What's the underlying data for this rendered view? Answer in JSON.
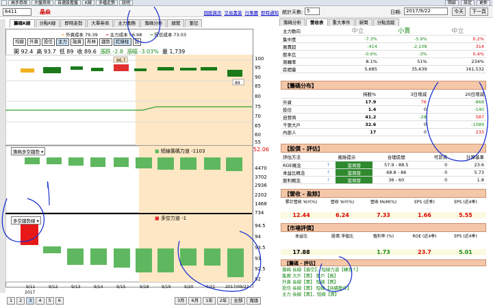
{
  "topbar": {
    "items": [
      "",
      "高手券商",
      "大盤券商",
      "自選股看盤",
      "K線",
      "多檔走勢",
      "說明"
    ],
    "right": [
      "",
      "開啟",
      "",
      "設定",
      "",
      "更新"
    ]
  },
  "header": {
    "code": "6411",
    "name": "晶焱",
    "links": [
      "個股資訊",
      "交易書簽",
      "行事曆",
      "即時通知"
    ]
  },
  "left_tabs": [
    "籌碼K線",
    "分點K線",
    "即時走勢",
    "大單券商",
    "主力動態",
    "籌碼分析",
    "總覽",
    "筆記"
  ],
  "legend": [
    {
      "label": "外資成本 79.39",
      "color": "#f0a030"
    },
    {
      "label": "主力成本 56.98",
      "color": "#e03030"
    },
    {
      "label": "投信成本 73.03",
      "color": "#30a030"
    }
  ],
  "buttons": [
    "均線",
    "外資",
    "投信",
    "主力",
    "融資",
    "布林",
    "趨勢",
    "紅綠柱",
    "說"
  ],
  "ohlc": {
    "open": "開 92.4",
    "high": "高 93.7",
    "low": "低 89",
    "close": "收 89.6",
    "change": "漲跌 -2.8",
    "pct": "漲幅 -3.03%",
    "vol": "量 1,739"
  },
  "price_axis": [
    "105",
    "100",
    "95",
    "90",
    "85",
    "80",
    "75",
    "70",
    "65",
    "60",
    "55",
    "52.06"
  ],
  "price_tags": {
    "hi": "96.7",
    "lo": "89"
  },
  "vol_axis": [
    "4470",
    "3702",
    "2936",
    "2202",
    "1468",
    "734",
    "0"
  ],
  "bbig_axis": [
    "94.5",
    "94",
    "93.5",
    "93",
    "92.5",
    "92"
  ],
  "panel2_title": "籌碼多空趨勢",
  "panel2_legend": "短線籌碼力道 -1103",
  "panel3_title": "多空趨勢線",
  "panel3_legend": "多空力道 -1",
  "dates": [
    "9/11",
    "9/12",
    "9/13",
    "9/14",
    "9/15",
    "9/18",
    "9/19",
    "9/20",
    "9/21",
    "2017/09/22"
  ],
  "year": "2017",
  "bottomnav": [
    "1",
    "2",
    "3",
    "4",
    "5",
    "6",
    "3月",
    "6月",
    "1年",
    "2年",
    "全部",
    "寬版"
  ],
  "right": {
    "days_label": "統計天數:",
    "days_value": "5",
    "date_label": "日期:",
    "date_value": "2017/9/22",
    "btns": [
      "今天",
      "下一頁"
    ],
    "tabs": [
      "籌碼分析",
      "營收表",
      "重大事件",
      "新聞",
      "分點追蹤"
    ],
    "top_rows": [
      {
        "label": "主力動向",
        "v1": "中立",
        "v2": "小賣",
        "v3": "中立"
      },
      {
        "label": "集中度",
        "v1": "-7.3%",
        "v2": "-5.9%",
        "v3": "0.2%"
      },
      {
        "label": "買賣超",
        "v1": "-414",
        "v2": "-2,108",
        "v3": "314"
      },
      {
        "label": "股本比",
        "v1": "-0.6%",
        "v2": "-3%",
        "v3": "0.4%"
      },
      {
        "label": "周轉率",
        "v1": "8.1%",
        "v2": "51%",
        "v3": "234%"
      },
      {
        "label": "區間量",
        "v1": "5,685",
        "v2": "35,639",
        "v3": "161,532"
      }
    ],
    "dist_title": "【籌碼分布】",
    "dist_head": [
      "",
      "持股%",
      "3日增減",
      "20日增減"
    ],
    "dist_rows": [
      [
        "外資",
        "17.9",
        "76",
        "-868"
      ],
      [
        "投信",
        "1.4",
        "0",
        "-140"
      ],
      [
        "自營商",
        "41.2",
        "-28",
        "587"
      ],
      [
        "千張大戶",
        "32.6",
        "0",
        "-1089"
      ],
      [
        "內部人",
        "17",
        "0",
        "233"
      ]
    ],
    "eval_title": "【股價 - 評估】",
    "eval_head": [
      "評估方法",
      "",
      "風險提示",
      "合理區間",
      "可昂貴",
      "計算基準"
    ],
    "eval_rows": [
      [
        "ROE概念",
        "?",
        "當周發",
        "57.9 - 88.5",
        "0",
        "23.6"
      ],
      [
        "本益比概念",
        "?",
        "當周發",
        "68.8 - 86",
        "0",
        "5.73"
      ],
      [
        "股利概念",
        "?",
        "當周發",
        "36 - 60",
        "0",
        "1.8"
      ]
    ],
    "rev_title": "【營收 - 盈餘】",
    "rev_head": [
      "累計營收 YoY(%)",
      "營收 YoY(%)",
      "營收 MoM(%)",
      "EPS (近季)",
      "EPS (近4季)"
    ],
    "rev_vals": [
      "12.44",
      "6.24",
      "7.33",
      "1.66",
      "5.55"
    ],
    "mkt_title": "【市場評價】",
    "mkt_head": [
      "本益比",
      "股價 淨值比",
      "殖利率 (%)",
      "ROE (近4季)",
      "EPS (近4季)"
    ],
    "mkt_vals": [
      "17.88",
      "",
      "1.73",
      "23.7",
      "5.01"
    ],
    "chip_title": "【籌碼 - 評估】",
    "chip_rows": [
      "籌碼 長線【偏空】，短線力道【轉強↑】",
      "集團 大戶【賣】  散戶【買】",
      "外資 長線【賣】  短線【賣】",
      "投信 長線【賣】  短線【持續動作】",
      "主力 長線【賣】，短線【賣】"
    ]
  }
}
